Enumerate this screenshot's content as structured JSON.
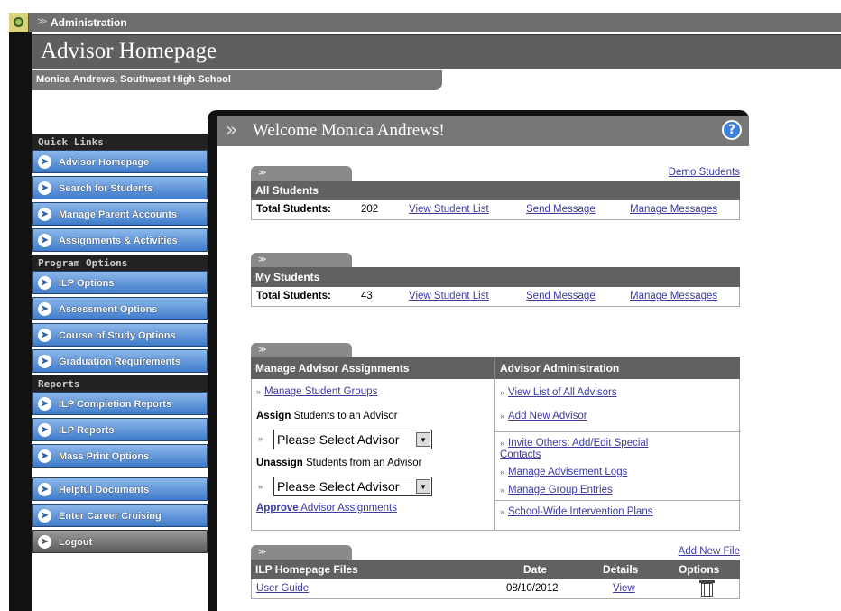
{
  "topbar": {
    "title": "Administration"
  },
  "header": {
    "page_title": "Advisor Homepage",
    "subtitle": "Monica Andrews, Southwest High School"
  },
  "sidebar": {
    "quick_links_header": "Quick Links",
    "quick_links": [
      {
        "label": "Advisor Homepage"
      },
      {
        "label": "Search for Students"
      },
      {
        "label": "Manage Parent Accounts"
      },
      {
        "label": "Assignments & Activities"
      }
    ],
    "program_header": "Program Options",
    "program_options": [
      {
        "label": "ILP Options"
      },
      {
        "label": "Assessment Options"
      },
      {
        "label": "Course of Study Options"
      },
      {
        "label": "Graduation Requirements"
      }
    ],
    "reports_header": "Reports",
    "reports": [
      {
        "label": "ILP Completion Reports"
      },
      {
        "label": "ILP Reports"
      },
      {
        "label": "Mass Print Options"
      }
    ],
    "other": [
      {
        "label": "Helpful Documents"
      },
      {
        "label": "Enter Career Cruising"
      }
    ],
    "logout": "Logout"
  },
  "main": {
    "welcome": "Welcome Monica Andrews!",
    "help": "?",
    "all_students": {
      "demo_link": "Demo Students",
      "title": "All Students",
      "total_label": "Total Students:",
      "total": "202",
      "links": [
        "View Student List",
        "Send Message",
        "Manage Messages"
      ]
    },
    "my_students": {
      "title": "My Students",
      "total_label": "Total Students:",
      "total": "43",
      "links": [
        "View Student List",
        "Send Message",
        "Manage Messages"
      ]
    },
    "assignments": {
      "left_title": "Manage Advisor Assignments",
      "manage_groups": "Manage Student Groups",
      "assign_bold": "Assign",
      "assign_rest": " Students to an Advisor",
      "select_placeholder": "Please Select Advisor",
      "unassign_bold": "Unassign",
      "unassign_rest": " Students from an Advisor",
      "approve_bold": "Approve",
      "approve_rest": " Advisor Assignments",
      "right_title": "Advisor Administration",
      "view_advisors": "View List of All Advisors",
      "add_advisor": "Add New Advisor",
      "invite_line1": "Invite Others: Add/Edit Special",
      "invite_line2": "Contacts",
      "advisement_logs": "Manage Advisement Logs",
      "group_entries": "Manage Group Entries",
      "intervention_plans": "School-Wide Intervention Plans"
    },
    "files": {
      "add_link": "Add New File",
      "title": "ILP Homepage Files",
      "col_date": "Date",
      "col_details": "Details",
      "col_options": "Options",
      "rows": [
        {
          "name": "User Guide",
          "date": "08/10/2012",
          "details": "View"
        }
      ]
    }
  }
}
